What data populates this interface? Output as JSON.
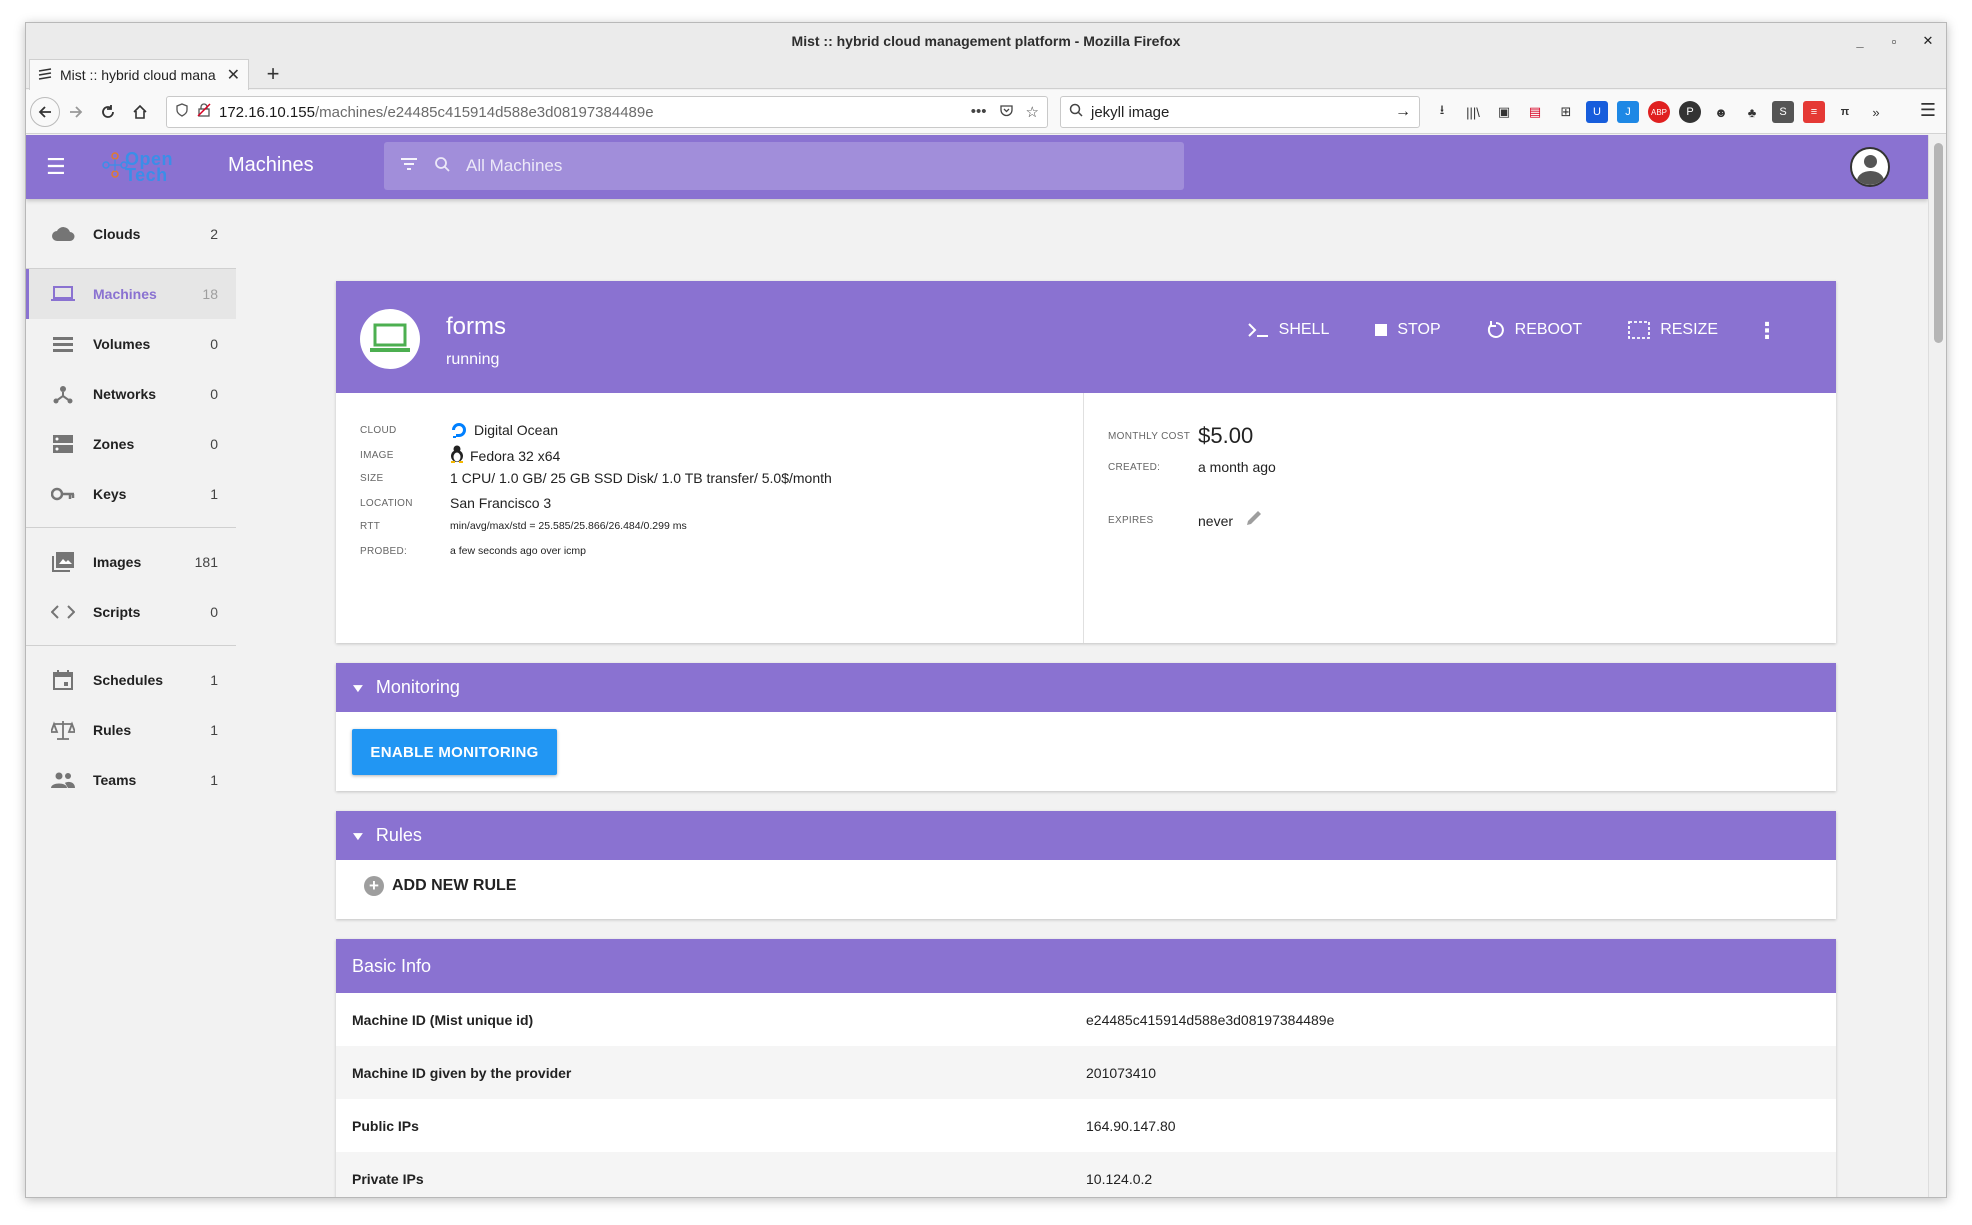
{
  "browser": {
    "window_title": "Mist :: hybrid cloud management platform - Mozilla Firefox",
    "tab_title": "Mist :: hybrid cloud mana",
    "url_host": "172.16.10.155",
    "url_path": "/machines/e24485c415914d588e3d08197384489e",
    "search_value": "jekyll image"
  },
  "appbar": {
    "logo_text_1": "Open",
    "logo_text_2": "Tech",
    "page_title": "Machines",
    "search_placeholder": "All Machines"
  },
  "sidebar": {
    "items": [
      {
        "label": "Clouds",
        "count": "2"
      },
      {
        "label": "Machines",
        "count": "18"
      },
      {
        "label": "Volumes",
        "count": "0"
      },
      {
        "label": "Networks",
        "count": "0"
      },
      {
        "label": "Zones",
        "count": "0"
      },
      {
        "label": "Keys",
        "count": "1"
      },
      {
        "label": "Images",
        "count": "181"
      },
      {
        "label": "Scripts",
        "count": "0"
      },
      {
        "label": "Schedules",
        "count": "1"
      },
      {
        "label": "Rules",
        "count": "1"
      },
      {
        "label": "Teams",
        "count": "1"
      }
    ]
  },
  "machine": {
    "name": "forms",
    "state": "running",
    "actions": {
      "shell": "SHELL",
      "stop": "STOP",
      "reboot": "REBOOT",
      "resize": "RESIZE"
    },
    "details": {
      "cloud_label": "CLOUD",
      "cloud": "Digital Ocean",
      "image_label": "IMAGE",
      "image": "Fedora 32 x64",
      "size_label": "SIZE",
      "size": "1 CPU/ 1.0 GB/ 25 GB SSD Disk/ 1.0 TB transfer/ 5.0$/month",
      "location_label": "LOCATION",
      "location": "San Francisco 3",
      "rtt_label": "RTT",
      "rtt": "min/avg/max/std = 25.585/25.866/26.484/0.299 ms",
      "probed_label": "PROBED:",
      "probed": "a few seconds ago over icmp"
    },
    "cost": {
      "monthly_label": "MONTHLY COST",
      "monthly": "$5.00",
      "created_label": "CREATED:",
      "created": "a month ago",
      "expires_label": "EXPIRES",
      "expires": "never"
    }
  },
  "monitoring": {
    "title": "Monitoring",
    "enable_label": "ENABLE MONITORING"
  },
  "rules": {
    "title": "Rules",
    "add_label": "ADD NEW RULE"
  },
  "basic_info": {
    "title": "Basic Info",
    "rows": [
      {
        "key": "Machine ID (Mist unique id)",
        "value": "e24485c415914d588e3d08197384489e"
      },
      {
        "key": "Machine ID given by the provider",
        "value": "201073410"
      },
      {
        "key": "Public IPs",
        "value": "164.90.147.80"
      },
      {
        "key": "Private IPs",
        "value": "10.124.0.2"
      }
    ]
  },
  "colors": {
    "brand": "#8a72d1",
    "primary_button": "#2196f3"
  }
}
